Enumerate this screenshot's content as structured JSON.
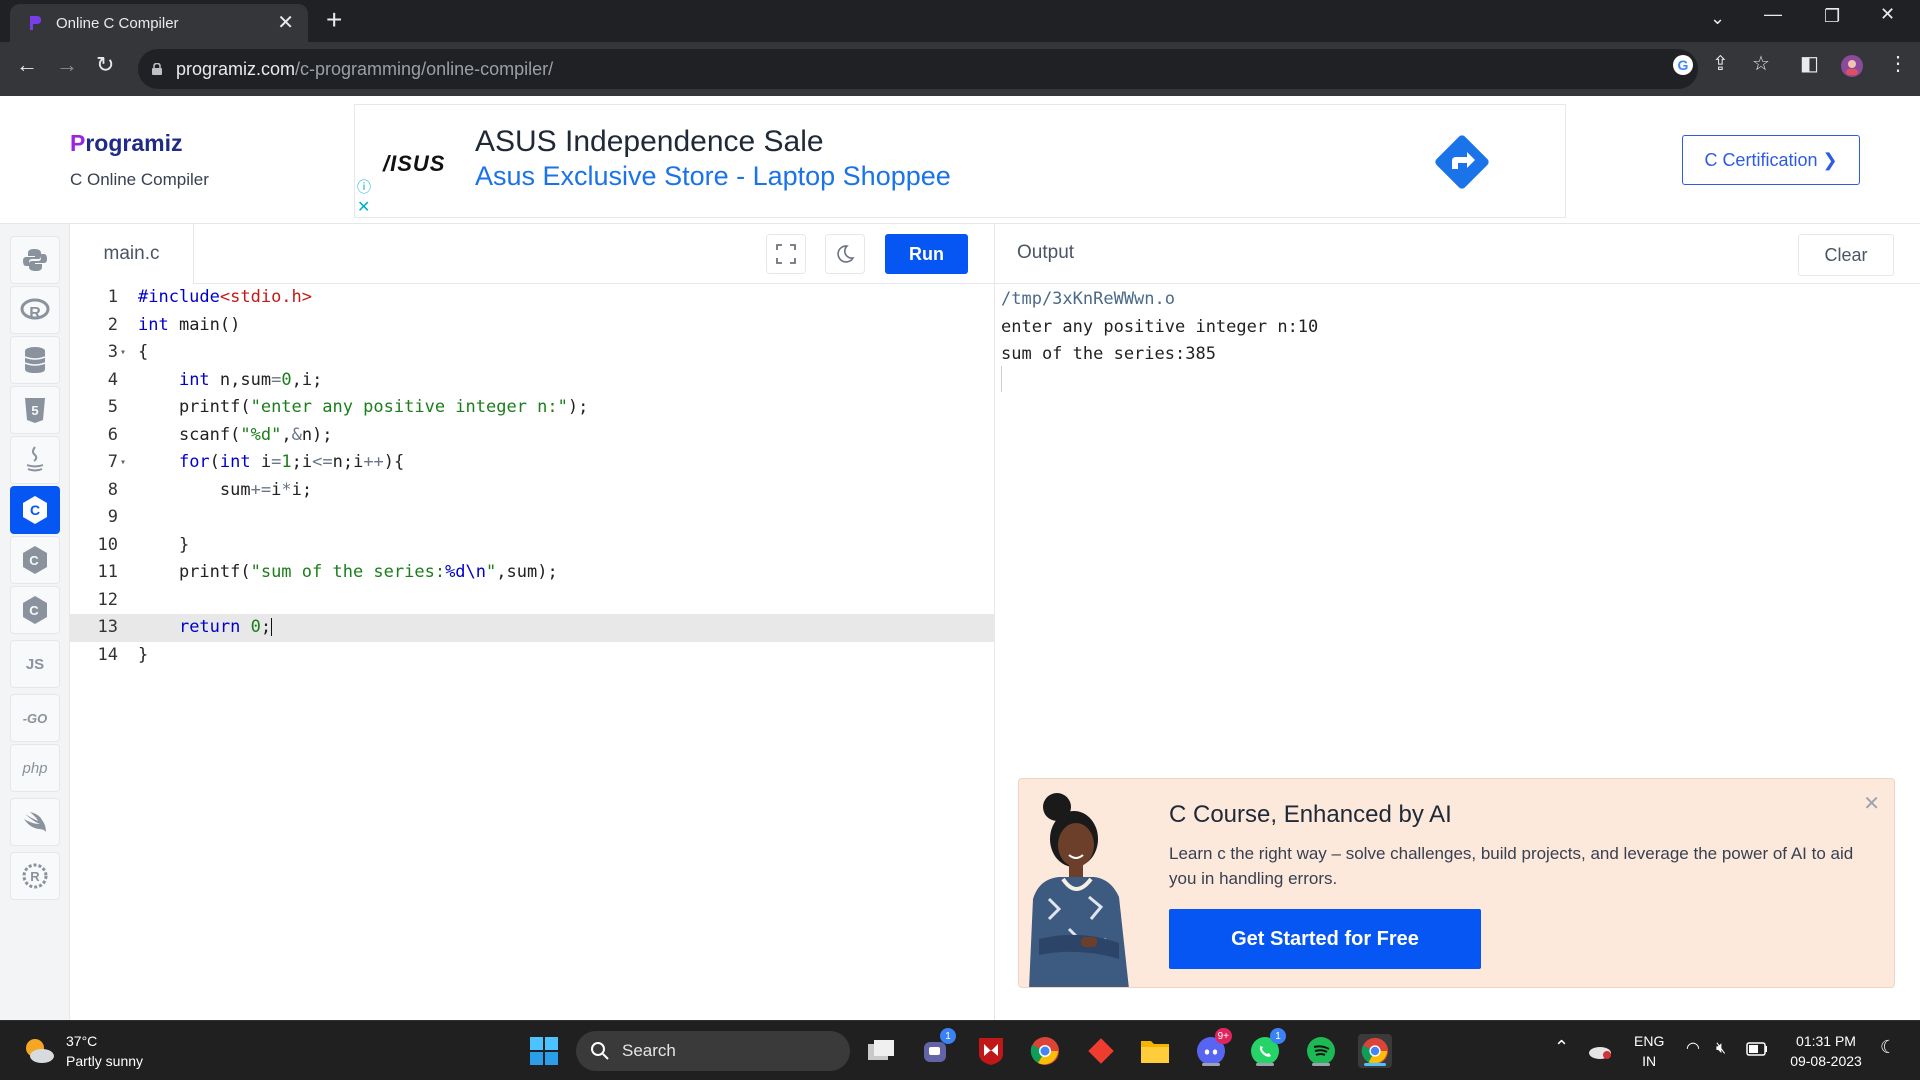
{
  "browser": {
    "tab_title": "Online C Compiler",
    "tab_close": "✕",
    "new_tab": "+",
    "url_host": "programiz.com",
    "url_path": "/c-programming/online-compiler/"
  },
  "site": {
    "brand": "rogramiz",
    "brand_first": "P",
    "brand_sub": "C Online Compiler",
    "cert_button": "C Certification ❯"
  },
  "ad": {
    "logo": "/ISUS",
    "title": "ASUS Independence Sale",
    "subtitle": "Asus Exclusive Store - Laptop Shoppee"
  },
  "sidebar": {
    "items": [
      {
        "name": "python",
        "label": ""
      },
      {
        "name": "r",
        "label": ""
      },
      {
        "name": "sql",
        "label": ""
      },
      {
        "name": "html",
        "label": ""
      },
      {
        "name": "java",
        "label": ""
      },
      {
        "name": "c",
        "label": "",
        "active": true
      },
      {
        "name": "cpp",
        "label": ""
      },
      {
        "name": "csharp",
        "label": ""
      },
      {
        "name": "js",
        "label": "JS"
      },
      {
        "name": "go",
        "label": "-GO"
      },
      {
        "name": "php",
        "label": "php"
      },
      {
        "name": "swift",
        "label": ""
      },
      {
        "name": "rust",
        "label": ""
      }
    ]
  },
  "editor": {
    "filename": "main.c",
    "run_label": "Run",
    "current_line": 13,
    "line_numbers": [
      "1",
      "2",
      "3",
      "4",
      "5",
      "6",
      "7",
      "8",
      "9",
      "10",
      "11",
      "12",
      "13",
      "14"
    ]
  },
  "output": {
    "title": "Output",
    "clear_label": "Clear",
    "lines": [
      "/tmp/3xKnReWWwn.o",
      "enter any positive integer n:10",
      "sum of the series:385"
    ]
  },
  "promo": {
    "title": "C Course, Enhanced by AI",
    "description": "Learn c the right way – solve challenges, build projects, and leverage the power of AI to aid you in handling errors.",
    "cta": "Get Started for Free",
    "close": "✕"
  },
  "taskbar": {
    "temperature": "37°C",
    "condition": "Partly sunny",
    "search_label": "Search",
    "teams_badge": "1",
    "discord_badge": "9+",
    "whatsapp_badge": "1",
    "lang_1": "ENG",
    "lang_2": "IN",
    "time": "01:31 PM",
    "date": "09-08-2023"
  },
  "colors": {
    "accent": "#0556f3",
    "brand_purple": "#9d23e0",
    "brand_navy": "#1f2b87",
    "promo_bg": "#fde8dc"
  }
}
